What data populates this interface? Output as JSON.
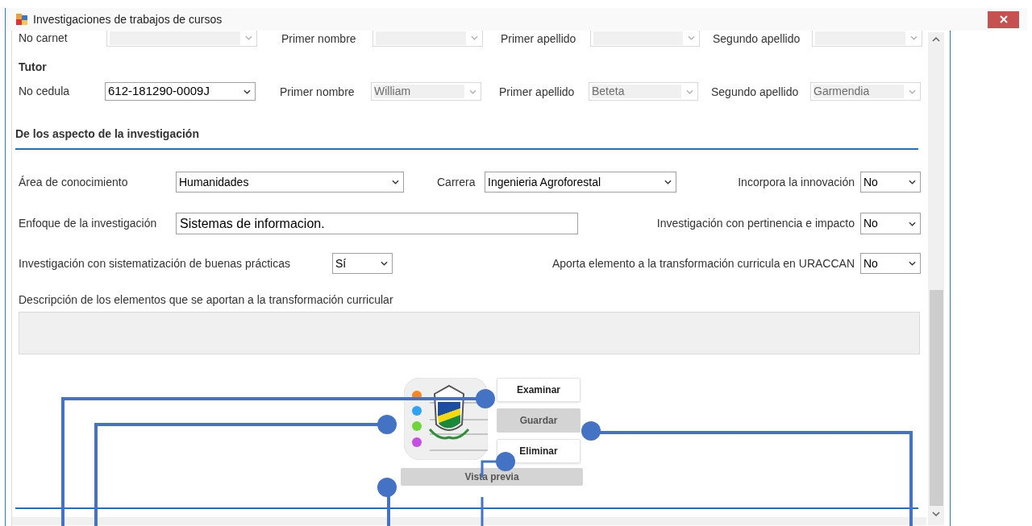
{
  "window": {
    "title": "Investigaciones de trabajos de cursos"
  },
  "student": {
    "fields": [
      {
        "label": "No carnet",
        "disabled": true
      },
      {
        "label": "Primer nombre",
        "disabled": true
      },
      {
        "label": "Primer apellido",
        "disabled": true
      },
      {
        "label": "Segundo apellido",
        "disabled": true
      }
    ]
  },
  "tutor": {
    "heading": "Tutor",
    "fields": [
      {
        "label": "No cedula",
        "value": "612-181290-0009J",
        "disabled": false
      },
      {
        "label": "Primer nombre",
        "value": "William",
        "disabled": true
      },
      {
        "label": "Primer apellido",
        "value": "Beteta",
        "disabled": true
      },
      {
        "label": "Segundo apellido",
        "value": "Garmendia",
        "disabled": true
      }
    ]
  },
  "aspects": {
    "heading": "De los aspecto de la investigación",
    "area": {
      "label": "Área de conocimiento",
      "value": "Humanidades"
    },
    "carrera": {
      "label": "Carrera",
      "value": "Ingenieria Agroforestal"
    },
    "innovacion": {
      "label": "Incorpora la innovación",
      "value": "No"
    },
    "enfoque": {
      "label": "Enfoque de la investigación",
      "value": "Sistemas de informacion."
    },
    "pertinencia": {
      "label": "Investigación con pertinencia e impacto",
      "value": "No"
    },
    "sistematizacion": {
      "label": "Investigación con sistematización de buenas prácticas",
      "value": "Sí"
    },
    "aporta": {
      "label": "Aporta elemento a la transformación curricula en URACCAN",
      "value": "No"
    },
    "descripcion": {
      "label": "Descripción de los elementos que se aportan a la transformación curricular"
    }
  },
  "buttons": [
    {
      "label": "Examinar",
      "kind": "raised"
    },
    {
      "label": "Guardar",
      "kind": "flat"
    },
    {
      "label": "Eliminar",
      "kind": "raised"
    }
  ],
  "preview_button": {
    "label": "Vista previa",
    "kind": "flat"
  }
}
